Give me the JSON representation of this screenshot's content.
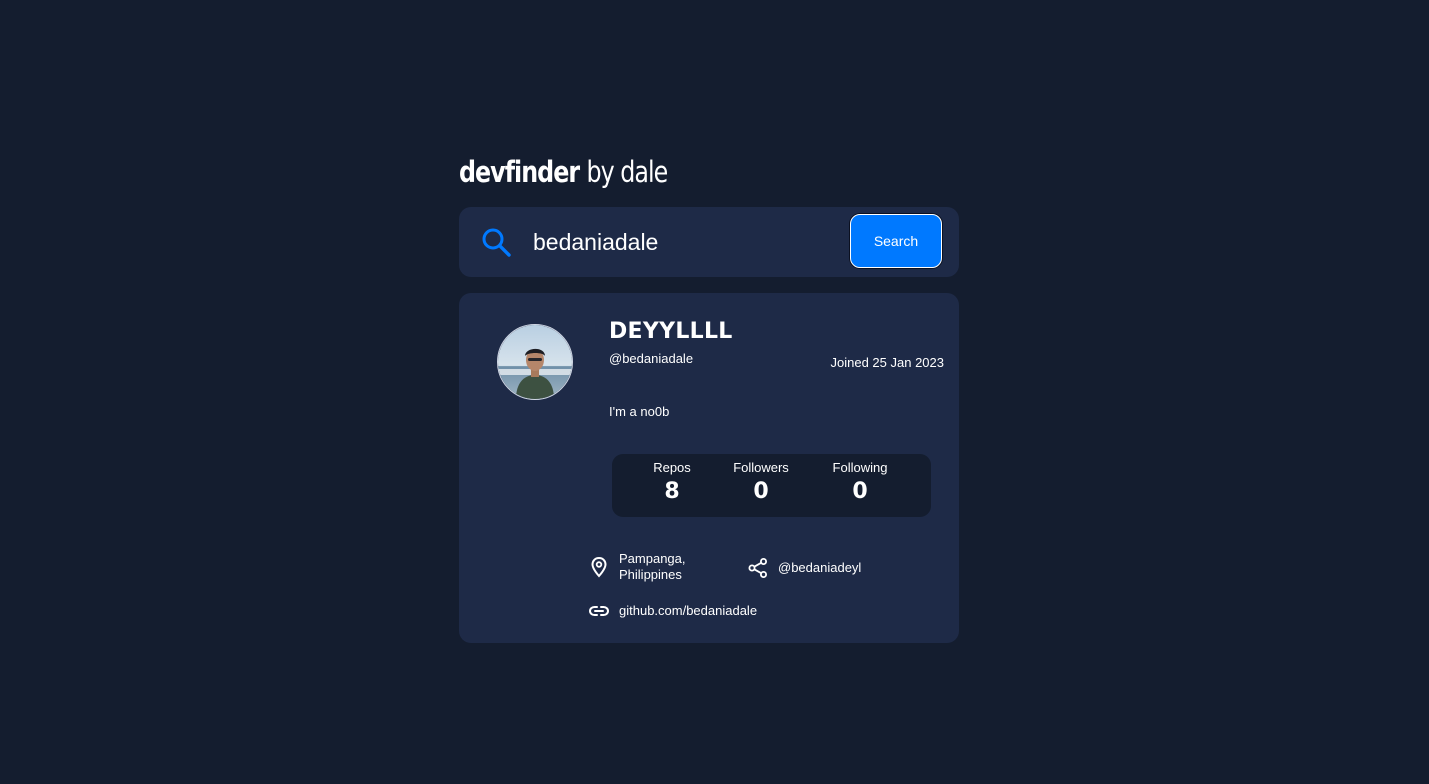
{
  "header": {
    "title_bold": "devfinder",
    "title_light": "by dale"
  },
  "search": {
    "value": "bedaniadale",
    "button_label": "Search",
    "icon": "search-icon"
  },
  "colors": {
    "background": "#141d2f",
    "card": "#1e2a47",
    "accent": "#0079ff",
    "text": "#ffffff"
  },
  "profile": {
    "name": "DEYYLLLL",
    "login": "@bedaniadale",
    "joined": "Joined 25 Jan 2023",
    "bio": "I'm a no0b",
    "stats": [
      {
        "label": "Repos",
        "value": "8"
      },
      {
        "label": "Followers",
        "value": "0"
      },
      {
        "label": "Following",
        "value": "0"
      }
    ],
    "links": {
      "location_line1": "Pampanga,",
      "location_line2": "Philippines",
      "twitter": "@bedaniadeyl",
      "website": "github.com/bedaniadale"
    },
    "icons": {
      "location": "location-pin-icon",
      "twitter": "share-icon",
      "website": "link-icon"
    }
  }
}
